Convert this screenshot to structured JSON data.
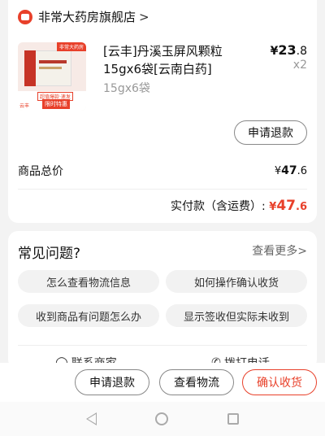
{
  "store": {
    "name": "非常大药房旗舰店",
    "chevron": ">"
  },
  "product": {
    "title": "[云丰]丹溪玉屏风颗粒 15gx6袋[云南白药]",
    "spec": "15gx6袋",
    "price_symbol": "¥",
    "price_int": "23",
    "price_dec": ".8",
    "quantity": "x2",
    "thumb": {
      "corner_tag": "非常大药房",
      "badge_a": "超值爆款·速发",
      "badge_b": "限时特惠",
      "badge_c": "云丰"
    }
  },
  "order_actions": {
    "refund_label": "申请退款"
  },
  "totals": {
    "goods_total_label": "商品总价",
    "goods_total_symbol": "¥",
    "goods_total_int": "47",
    "goods_total_dec": ".6",
    "paid_label": "实付款（含运费）:",
    "paid_symbol": "¥",
    "paid_int": "47",
    "paid_dec": ".6"
  },
  "faq": {
    "title": "常见问题?",
    "more_label": "查看更多",
    "more_chevron": ">",
    "questions": [
      "怎么查看物流信息",
      "如何操作确认收货",
      "收到商品有问题怎么办",
      "显示签收但实际未收到"
    ],
    "contact_seller": "联系商家",
    "call_phone": "拨打电话"
  },
  "bottom_bar": {
    "refund_label": "申请退款",
    "logistics_label": "查看物流",
    "confirm_label": "确认收货"
  },
  "colors": {
    "accent": "#e8402a",
    "background": "#f3f3f3"
  }
}
